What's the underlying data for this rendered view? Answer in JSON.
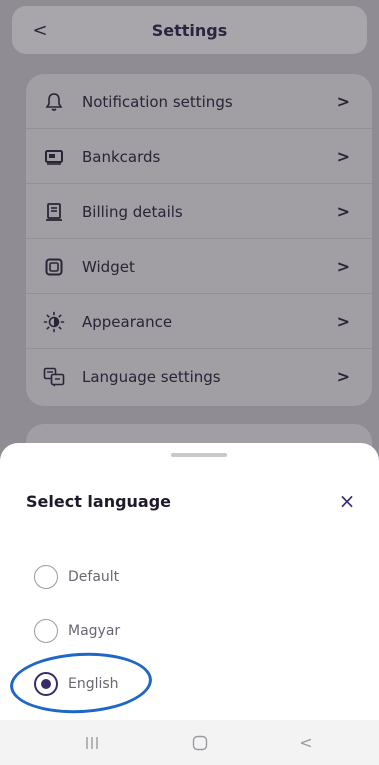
{
  "header": {
    "back_icon": "chevron-left-icon",
    "back_glyph": "<",
    "title": "Settings"
  },
  "settings": {
    "chevron_glyph": ">",
    "items": [
      {
        "label": "Notification settings",
        "icon": "bell-icon"
      },
      {
        "label": "Bankcards",
        "icon": "bankcard-icon"
      },
      {
        "label": "Billing details",
        "icon": "receipt-icon"
      },
      {
        "label": "Widget",
        "icon": "widget-icon"
      },
      {
        "label": "Appearance",
        "icon": "sun-half-icon"
      },
      {
        "label": "Language settings",
        "icon": "translate-icon"
      }
    ]
  },
  "sheet": {
    "title": "Select language",
    "close_icon": "close-icon",
    "close_glyph": "×",
    "options": [
      {
        "label": "Default",
        "selected": false
      },
      {
        "label": "Magyar",
        "selected": false
      },
      {
        "label": "English",
        "selected": true
      }
    ]
  },
  "colors": {
    "accent": "#3a2a66",
    "highlight_annotation": "#1e66c8"
  },
  "navbar": {
    "recents_icon": "recents-icon",
    "home_icon": "home-icon",
    "back_icon": "back-icon",
    "back_glyph": "<"
  }
}
